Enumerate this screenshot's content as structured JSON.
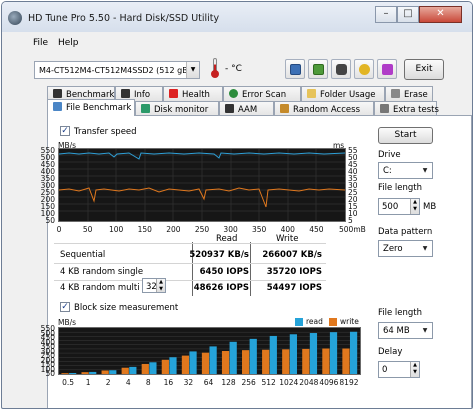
{
  "window": {
    "title": "HD Tune Pro 5.50 - Hard Disk/SSD Utility",
    "min": "–",
    "max": "□",
    "close": "✕"
  },
  "menu": {
    "file": "File",
    "help": "Help"
  },
  "toolbar": {
    "drive": "M4-CT512M4-CT512M4SSD2 (512 gB)",
    "temp": "- °C",
    "exit": "Exit"
  },
  "tabs_top": [
    "Benchmark",
    "Info",
    "Health",
    "Error Scan",
    "Folder Usage",
    "Erase"
  ],
  "tabs_bottom": [
    "File Benchmark",
    "Disk monitor",
    "AAM",
    "Random Access",
    "Extra tests"
  ],
  "transfer": {
    "label": "Transfer speed",
    "checked": true,
    "y_unit": "MB/s",
    "y2_unit": "ms",
    "y_ticks": [
      "550",
      "500",
      "450",
      "400",
      "350",
      "300",
      "250",
      "200",
      "150",
      "100",
      "50"
    ],
    "y2_ticks": [
      "55",
      "50",
      "45",
      "40",
      "35",
      "30",
      "25",
      "20",
      "15",
      "10",
      "5"
    ],
    "x_ticks": [
      "0",
      "50",
      "100",
      "150",
      "200",
      "250",
      "300",
      "350",
      "400",
      "450",
      "500mB"
    ],
    "colors": {
      "read": "#2e9fd6",
      "access": "#e0781e"
    }
  },
  "results": {
    "col_read": "Read",
    "col_write": "Write",
    "rows": [
      {
        "label": "Sequential",
        "read": "520937 KB/s",
        "write": "266007 KB/s"
      },
      {
        "label": "4 KB random single",
        "read": "6450 IOPS",
        "write": "35720 IOPS"
      },
      {
        "label": "4 KB random multi",
        "read": "48626 IOPS",
        "write": "54497 IOPS",
        "queue": "32"
      }
    ]
  },
  "right": {
    "start": "Start",
    "drive_label": "Drive",
    "drive_value": "C:",
    "file_length_label": "File length",
    "file_length_value": "500",
    "file_length_unit": "MB",
    "pattern_label": "Data pattern",
    "pattern_value": "Zero",
    "file_length2_label": "File length",
    "file_length2_value": "64 MB",
    "delay_label": "Delay",
    "delay_value": "0"
  },
  "block": {
    "label": "Block size measurement",
    "checked": true,
    "y_unit": "MB/s",
    "legend_read": "read",
    "legend_write": "write",
    "y_ticks": [
      "550",
      "500",
      "450",
      "400",
      "350",
      "300",
      "250",
      "200",
      "150",
      "100",
      "50"
    ],
    "colors": {
      "read": "#25a3d9",
      "write": "#e0781e"
    }
  },
  "chart_data": {
    "type": "bar",
    "categories": [
      "0.5",
      "1",
      "2",
      "4",
      "8",
      "16",
      "32",
      "64",
      "128",
      "256",
      "512",
      "1024",
      "2048",
      "4096",
      "8192"
    ],
    "series": [
      {
        "name": "read",
        "values": [
          12,
          25,
          45,
          85,
          140,
          200,
          270,
          330,
          385,
          420,
          455,
          475,
          490,
          500,
          505
        ]
      },
      {
        "name": "write",
        "values": [
          10,
          22,
          42,
          75,
          120,
          170,
          220,
          255,
          275,
          285,
          290,
          295,
          300,
          305,
          305
        ]
      }
    ],
    "ylabel": "MB/s",
    "ylim": [
      0,
      550
    ]
  }
}
